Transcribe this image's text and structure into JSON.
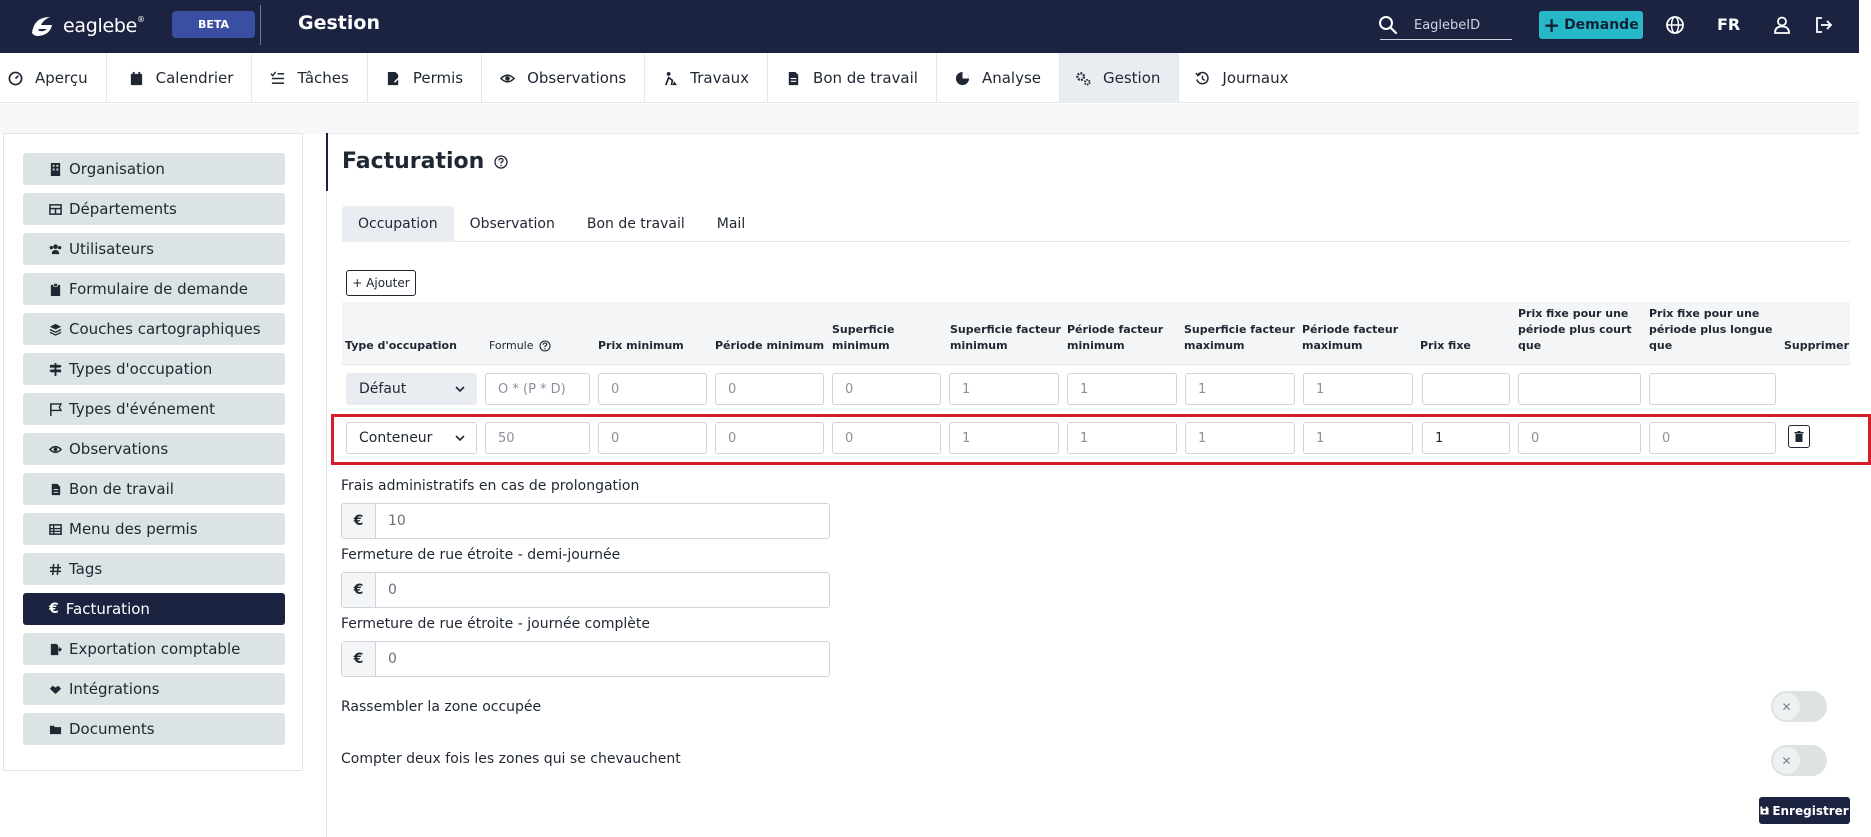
{
  "header": {
    "brand": "eaglebe",
    "brand_mark": "®",
    "beta": "BETA",
    "title": "Gestion",
    "search_placeholder": "EaglebeID",
    "demande_label": "Demande",
    "lang": "FR"
  },
  "nav": {
    "tabs": [
      {
        "label": "Aperçu",
        "icon": "dashboard-icon"
      },
      {
        "label": "Calendrier",
        "icon": "calendar-icon"
      },
      {
        "label": "Tâches",
        "icon": "tasks-icon"
      },
      {
        "label": "Permis",
        "icon": "permit-icon"
      },
      {
        "label": "Observations",
        "icon": "eye-icon"
      },
      {
        "label": "Travaux",
        "icon": "works-icon"
      },
      {
        "label": "Bon de travail",
        "icon": "document-icon"
      },
      {
        "label": "Analyse",
        "icon": "analytics-icon"
      },
      {
        "label": "Gestion",
        "icon": "gears-icon",
        "active": true
      },
      {
        "label": "Journaux",
        "icon": "history-icon"
      }
    ]
  },
  "sidebar": {
    "items": [
      {
        "label": "Organisation",
        "icon": "building-icon"
      },
      {
        "label": "Départements",
        "icon": "table-icon"
      },
      {
        "label": "Utilisateurs",
        "icon": "users-icon"
      },
      {
        "label": "Formulaire de demande",
        "icon": "clipboard-icon"
      },
      {
        "label": "Couches cartographiques",
        "icon": "layers-icon"
      },
      {
        "label": "Types d'occupation",
        "icon": "signs-icon"
      },
      {
        "label": "Types d'événement",
        "icon": "flag-icon"
      },
      {
        "label": "Observations",
        "icon": "eye-icon"
      },
      {
        "label": "Bon de travail",
        "icon": "file-icon"
      },
      {
        "label": "Menu des permis",
        "icon": "table-icon"
      },
      {
        "label": "Tags",
        "icon": "hashtag-icon"
      },
      {
        "label": "Facturation",
        "icon": "euro-icon",
        "active": true
      },
      {
        "label": "Exportation comptable",
        "icon": "file-export-icon"
      },
      {
        "label": "Intégrations",
        "icon": "handshake-icon"
      },
      {
        "label": "Documents",
        "icon": "folder-icon"
      }
    ]
  },
  "main": {
    "title": "Facturation",
    "subtabs": [
      "Occupation",
      "Observation",
      "Bon de travail",
      "Mail"
    ],
    "add_label": "+ Ajouter",
    "columns": [
      "Type d'occupation",
      "Formule",
      "Prix minimum",
      "Période minimum",
      "Superficie minimum",
      "Superficie facteur minimum",
      "Période facteur minimum",
      "Superficie facteur maximum",
      "Période facteur maximum",
      "Prix fixe",
      "Prix fixe pour une période plus court que",
      "Prix fixe pour une période plus longue que",
      "Supprimer"
    ],
    "rows": [
      {
        "type": "Défaut",
        "cells": [
          "O * (P * D)",
          "0",
          "0",
          "0",
          "1",
          "1",
          "1",
          "1",
          "",
          "",
          ""
        ]
      },
      {
        "type": "Conteneur",
        "cells": [
          "50",
          "0",
          "0",
          "0",
          "1",
          "1",
          "1",
          "1",
          "1",
          "0",
          "0"
        ]
      }
    ],
    "fields": [
      {
        "label": "Frais administratifs en cas de prolongation",
        "prefix": "€",
        "value": "10"
      },
      {
        "label": "Fermeture de rue étroite - demi-journée",
        "prefix": "€",
        "value": "0"
      },
      {
        "label": "Fermeture de rue étroite - journée complète",
        "prefix": "€",
        "value": "0"
      }
    ],
    "toggles": [
      {
        "label": "Rassembler la zone occupée",
        "on": false
      },
      {
        "label": "Compter deux fois les zones qui se chevauchent",
        "on": false
      }
    ],
    "save_label": "Enregistrer"
  }
}
